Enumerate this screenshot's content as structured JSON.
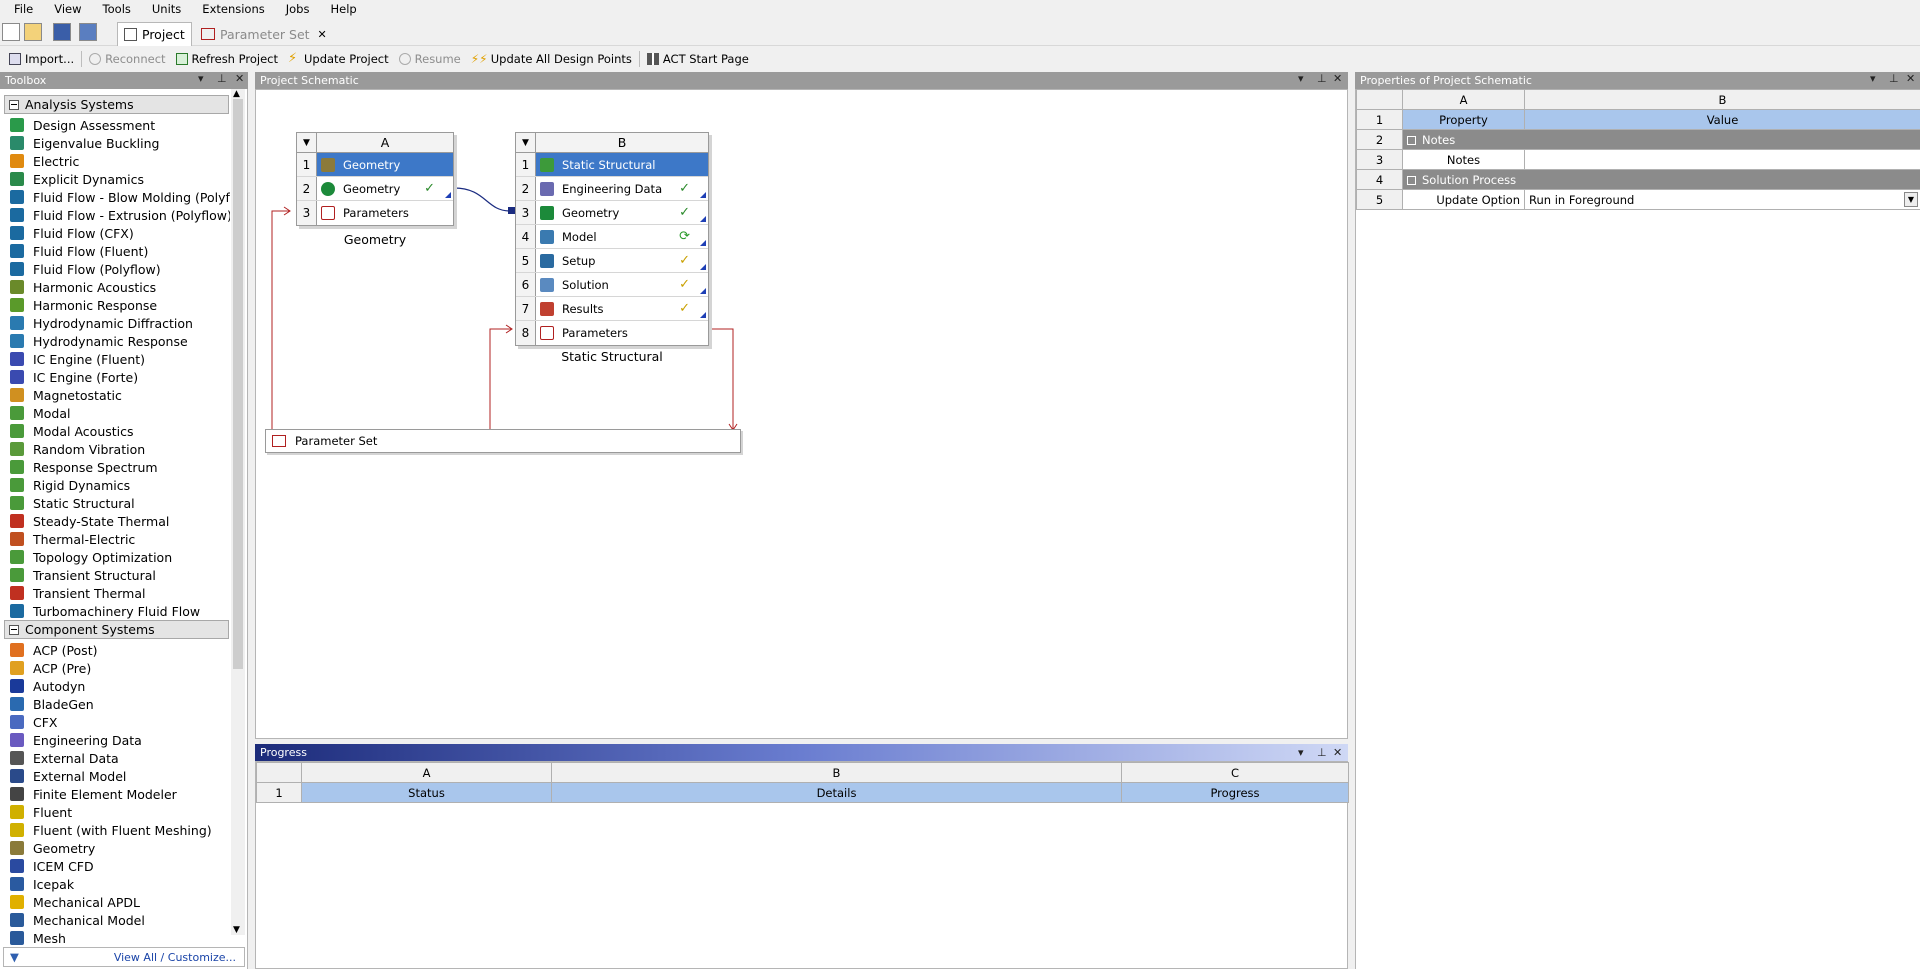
{
  "menu": [
    "File",
    "View",
    "Tools",
    "Units",
    "Extensions",
    "Jobs",
    "Help"
  ],
  "tabs": {
    "project": "Project",
    "parameter_set": "Parameter Set",
    "close": "✕"
  },
  "toolbar": {
    "import": "Import...",
    "reconnect": "Reconnect",
    "refresh": "Refresh Project",
    "update": "Update Project",
    "resume": "Resume",
    "update_all": "Update All Design Points",
    "act": "ACT Start Page"
  },
  "toolbox": {
    "title": "Toolbox",
    "analysis_title": "Analysis Systems",
    "analysis": [
      "Design Assessment",
      "Eigenvalue Buckling",
      "Electric",
      "Explicit Dynamics",
      "Fluid Flow - Blow Molding (Polyflo",
      "Fluid Flow - Extrusion (Polyflow)",
      "Fluid Flow (CFX)",
      "Fluid Flow (Fluent)",
      "Fluid Flow (Polyflow)",
      "Harmonic Acoustics",
      "Harmonic Response",
      "Hydrodynamic Diffraction",
      "Hydrodynamic Response",
      "IC Engine (Fluent)",
      "IC Engine (Forte)",
      "Magnetostatic",
      "Modal",
      "Modal Acoustics",
      "Random Vibration",
      "Response Spectrum",
      "Rigid Dynamics",
      "Static Structural",
      "Steady-State Thermal",
      "Thermal-Electric",
      "Topology Optimization",
      "Transient Structural",
      "Transient Thermal",
      "Turbomachinery Fluid Flow"
    ],
    "component_title": "Component Systems",
    "component": [
      "ACP (Post)",
      "ACP (Pre)",
      "Autodyn",
      "BladeGen",
      "CFX",
      "Engineering Data",
      "External Data",
      "External Model",
      "Finite Element Modeler",
      "Fluent",
      "Fluent (with Fluent Meshing)",
      "Geometry",
      "ICEM CFD",
      "Icepak",
      "Mechanical APDL",
      "Mechanical Model",
      "Mesh"
    ],
    "view_all": "View All / Customize..."
  },
  "schematic": {
    "title": "Project Schematic",
    "sysA": {
      "col": "A",
      "rows": [
        {
          "n": "1",
          "label": "Geometry"
        },
        {
          "n": "2",
          "label": "Geometry",
          "status": "✓"
        },
        {
          "n": "3",
          "label": "Parameters"
        }
      ],
      "caption": "Geometry"
    },
    "sysB": {
      "col": "B",
      "rows": [
        {
          "n": "1",
          "label": "Static Structural"
        },
        {
          "n": "2",
          "label": "Engineering Data",
          "status": "✓"
        },
        {
          "n": "3",
          "label": "Geometry",
          "status": "✓"
        },
        {
          "n": "4",
          "label": "Model",
          "status": "⟳"
        },
        {
          "n": "5",
          "label": "Setup",
          "status": "✓"
        },
        {
          "n": "6",
          "label": "Solution",
          "status": "✓"
        },
        {
          "n": "7",
          "label": "Results",
          "status": "✓"
        },
        {
          "n": "8",
          "label": "Parameters"
        }
      ],
      "caption": "Static Structural"
    },
    "parameter_set": "Parameter Set"
  },
  "progress": {
    "title": "Progress",
    "cols": [
      "A",
      "B",
      "C"
    ],
    "headers": [
      "Status",
      "Details",
      "Progress"
    ],
    "row": "1"
  },
  "properties": {
    "title": "Properties of Project Schematic",
    "cols": [
      "A",
      "B"
    ],
    "rows": [
      {
        "n": "1",
        "a": "Property",
        "b": "Value"
      },
      {
        "n": "2",
        "a": "Notes"
      },
      {
        "n": "3",
        "a": "Notes",
        "b": ""
      },
      {
        "n": "4",
        "a": "Solution Process"
      },
      {
        "n": "5",
        "a": "Update Option",
        "b": "Run in Foreground"
      }
    ]
  },
  "colors": {
    "accent": "#3d78c8",
    "header_gray": "#9a9a9a",
    "link_red": "#b02020",
    "link_blue": "#1a2b80"
  }
}
